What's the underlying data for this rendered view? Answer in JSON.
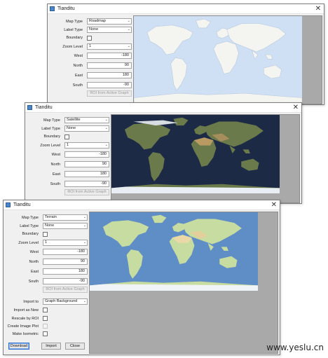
{
  "windows": {
    "roadmap": {
      "title": "Tianditu",
      "map_type_label": "Map Type",
      "map_type_value": "Roadmap",
      "label_type_label": "Label Type",
      "label_type_value": "None",
      "boundary_label": "Boundary",
      "zoom_label": "Zoom Level",
      "zoom_value": "1",
      "west_label": "West",
      "west_value": "-180",
      "north_label": "North",
      "north_value": "90",
      "east_label": "East",
      "east_value": "180",
      "south_label": "South",
      "south_value": "-90",
      "roi_button": "ROI from Active Graph"
    },
    "satellite": {
      "title": "Tianditu",
      "map_type_label": "Map Type",
      "map_type_value": "Satellite",
      "label_type_label": "Label Type",
      "label_type_value": "None",
      "boundary_label": "Boundary",
      "zoom_label": "Zoom Level",
      "zoom_value": "1",
      "west_label": "West",
      "west_value": "-180",
      "north_label": "North",
      "north_value": "90",
      "east_label": "East",
      "east_value": "180",
      "south_label": "South",
      "south_value": "-90",
      "roi_button": "ROI from Active Graph"
    },
    "terrain": {
      "title": "Tianditu",
      "map_type_label": "Map Type",
      "map_type_value": "Terrain",
      "label_type_label": "Label Type",
      "label_type_value": "None",
      "boundary_label": "Boundary",
      "zoom_label": "Zoom Level",
      "zoom_value": "1",
      "west_label": "West",
      "west_value": "-180",
      "north_label": "North",
      "north_value": "90",
      "east_label": "East",
      "east_value": "180",
      "south_label": "South",
      "south_value": "-90",
      "roi_button": "ROI from Active Graph",
      "import_to_label": "Import to",
      "import_to_value": "Graph Background",
      "import_as_new_label": "Import as New",
      "rescale_by_roi_label": "Rescale by ROI",
      "create_image_plot_label": "Create Image Plot",
      "make_isometric_label": "Make Isometric",
      "download_button": "Download",
      "import_button": "Import",
      "close_button": "Close"
    }
  },
  "icons": {
    "close": "close-icon",
    "app": "app-icon",
    "dropdown": "chevron-down-icon"
  },
  "colors": {
    "roadmap_ocean": "#cfe0f5",
    "roadmap_land": "#f4f4f0",
    "satellite_ocean": "#1d2a46",
    "satellite_land": "#6b7a4a",
    "terrain_ocean": "#5f8dc5",
    "terrain_land": "#c7dca0"
  },
  "watermark": "www.yeslu.cn"
}
